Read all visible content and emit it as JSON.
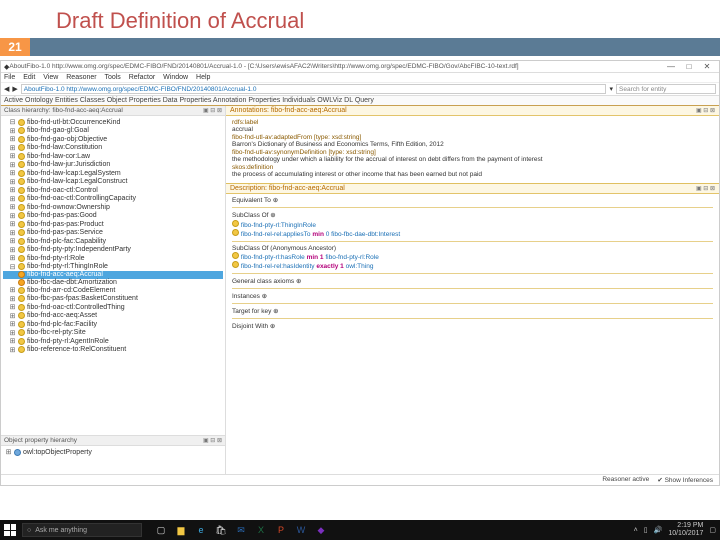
{
  "slide": {
    "title": "Draft Definition of Accrual",
    "number": "21"
  },
  "window": {
    "title": "AboutFibo-1.0  http://www.omg.org/spec/EDMC-FIBO/FND/20140801/Accrual-1.0  - [C:\\Users\\ewisAFAC2\\Writers\\http://www.omg.org/spec/EDMC-FIBO/Gov/AbcFIBC-10-text.rdf]",
    "menu": [
      "File",
      "Edit",
      "View",
      "Reasoner",
      "Tools",
      "Refactor",
      "Window",
      "Help"
    ],
    "url": "AboutFibo-1.0  http://www.omg.org/spec/EDMC-FIBO/FND/20140801/Accrual-1.0",
    "search_placeholder": "Search for entity",
    "tab": "Active Ontology   Entities   Classes   Object Properties   Data Properties   Annotation Properties   Individuals   OWLViz   DL Query"
  },
  "left": {
    "panel_title": "Class hierarchy: fibo-fnd-acc-aeq:Accrual",
    "items": [
      {
        "exp": "⊟",
        "b": "yellow",
        "txt": "fibo-fnd-utl-bt:OccurrenceKind"
      },
      {
        "exp": "⊞",
        "b": "yellow",
        "txt": "fibo-fnd-gao-gl:Goal"
      },
      {
        "exp": "⊞",
        "b": "yellow",
        "txt": "fibo-fnd-gao-obj:Objective"
      },
      {
        "exp": "⊞",
        "b": "yellow",
        "txt": "fibo-fnd-law:Constitution"
      },
      {
        "exp": "⊞",
        "b": "yellow",
        "txt": "fibo-fnd-law-cor:Law"
      },
      {
        "exp": "⊞",
        "b": "yellow",
        "txt": "fibo-fnd-law-jur:Jurisdiction"
      },
      {
        "exp": "⊞",
        "b": "yellow",
        "txt": "fibo-fnd-law-lcap:LegalSystem"
      },
      {
        "exp": "⊞",
        "b": "yellow",
        "txt": "fibo-fnd-law-lcap:LegalConstruct"
      },
      {
        "exp": "⊞",
        "b": "yellow",
        "txt": "fibo-fnd-oac-ctl:Control"
      },
      {
        "exp": "⊞",
        "b": "yellow",
        "txt": "fibo-fnd-oac-ctl:ControllingCapacity"
      },
      {
        "exp": "⊞",
        "b": "yellow",
        "txt": "fibo-fnd-ownow:Ownership"
      },
      {
        "exp": "⊞",
        "b": "yellow",
        "txt": "fibo-fnd-pas-pas:Good"
      },
      {
        "exp": "⊞",
        "b": "yellow",
        "txt": "fibo-fnd-pas-pas:Product"
      },
      {
        "exp": "⊞",
        "b": "yellow",
        "txt": "fibo-fnd-pas-pas:Service"
      },
      {
        "exp": "⊞",
        "b": "yellow",
        "txt": "fibo-fnd-plc-fac:Capability"
      },
      {
        "exp": "⊞",
        "b": "yellow",
        "txt": "fibo-fnd-pty-pty:IndependentParty"
      },
      {
        "exp": "⊞",
        "b": "yellow",
        "txt": "fibo-fnd-pty-rl:Role"
      },
      {
        "exp": "⊟",
        "b": "yellow",
        "txt": "fibo-fnd-pty-rl:ThingInRole"
      },
      {
        "exp": "",
        "b": "orange",
        "txt": "fibo-fnd-acc-aeq:Accrual",
        "sel": true
      },
      {
        "exp": "",
        "b": "orange",
        "txt": "fibo-fbc-dae-dbt:Amortization"
      },
      {
        "exp": "⊞",
        "b": "yellow",
        "txt": "fibo-fnd-arr-cd:CodeElement"
      },
      {
        "exp": "⊞",
        "b": "yellow",
        "txt": "fibo-fbc-pas-fpas:BasketConstituent"
      },
      {
        "exp": "⊞",
        "b": "yellow",
        "txt": "fibo-fnd-oac-ctl:ControlledThing"
      },
      {
        "exp": "⊞",
        "b": "yellow",
        "txt": "fibo-fnd-acc-aeq:Asset"
      },
      {
        "exp": "⊞",
        "b": "yellow",
        "txt": "fibo-fnd-plc-fac:Facility"
      },
      {
        "exp": "⊞",
        "b": "yellow",
        "txt": "fibo-fbc-rel-pty:Site"
      },
      {
        "exp": "⊞",
        "b": "yellow",
        "txt": "fibo-fnd-pty-rl:AgentInRole"
      },
      {
        "exp": "⊞",
        "b": "yellow",
        "txt": "fibo-reference-to:RelConstituent"
      }
    ],
    "lower_title": "Object property hierarchy",
    "lower_item": "owl:topObjectProperty"
  },
  "right": {
    "ann_title": "Annotations: fibo-fnd-acc-aeq:Accrual",
    "ann": {
      "rdfs_label_k": "rdfs:label",
      "rdfs_label_v": "accrual",
      "adapted_k": "fibo-fnd-utl-av:adaptedFrom    [type: xsd:string]",
      "adapted_v": "Barron's Dictionary of Business and Economics Terms, Fifth Edition, 2012",
      "syn_k": "fibo-fnd-utl-av:synonymDefinition    [type: xsd:string]",
      "syn_v": "the methodology under which a liability for the accrual of interest on debt differs from the payment of interest",
      "def_k": "skos:definition",
      "def_v": "the process of accumulating interest or other income that has been earned but not paid"
    },
    "desc_title": "Description: fibo-fnd-acc-aeq:Accrual",
    "desc": {
      "equivto": "Equivalent To ⊕",
      "subof": "SubClass Of ⊕",
      "s1_a": "fibo-fnd-pty-rl:ThingInRole",
      "s2_a": "fibo-fnd-rel-rel:appliesTo ",
      "s2_b": "min ",
      "s2_c": "0 fibo-fbc-dae-dbt:Interest",
      "subof_anon": "SubClass Of (Anonymous Ancestor)",
      "a1_a": "fibo-fnd-pty-rl:hasRole ",
      "a1_b": "min 1 ",
      "a1_c": "fibo-fnd-pty-rl:Role",
      "a2_a": "fibo-fnd-rel-rel:hasIdentity ",
      "a2_b": "exactly 1 ",
      "a2_c": "owl:Thing",
      "gca": "General class axioms ⊕",
      "inst": "Instances ⊕",
      "target": "Target for key ⊕",
      "disj": "Disjoint With ⊕"
    },
    "status": {
      "reasoner": "Reasoner active",
      "show": "Show Inferences"
    }
  },
  "taskbar": {
    "search": "Ask me anything",
    "time": "2:19 PM",
    "date": "10/10/2017"
  }
}
